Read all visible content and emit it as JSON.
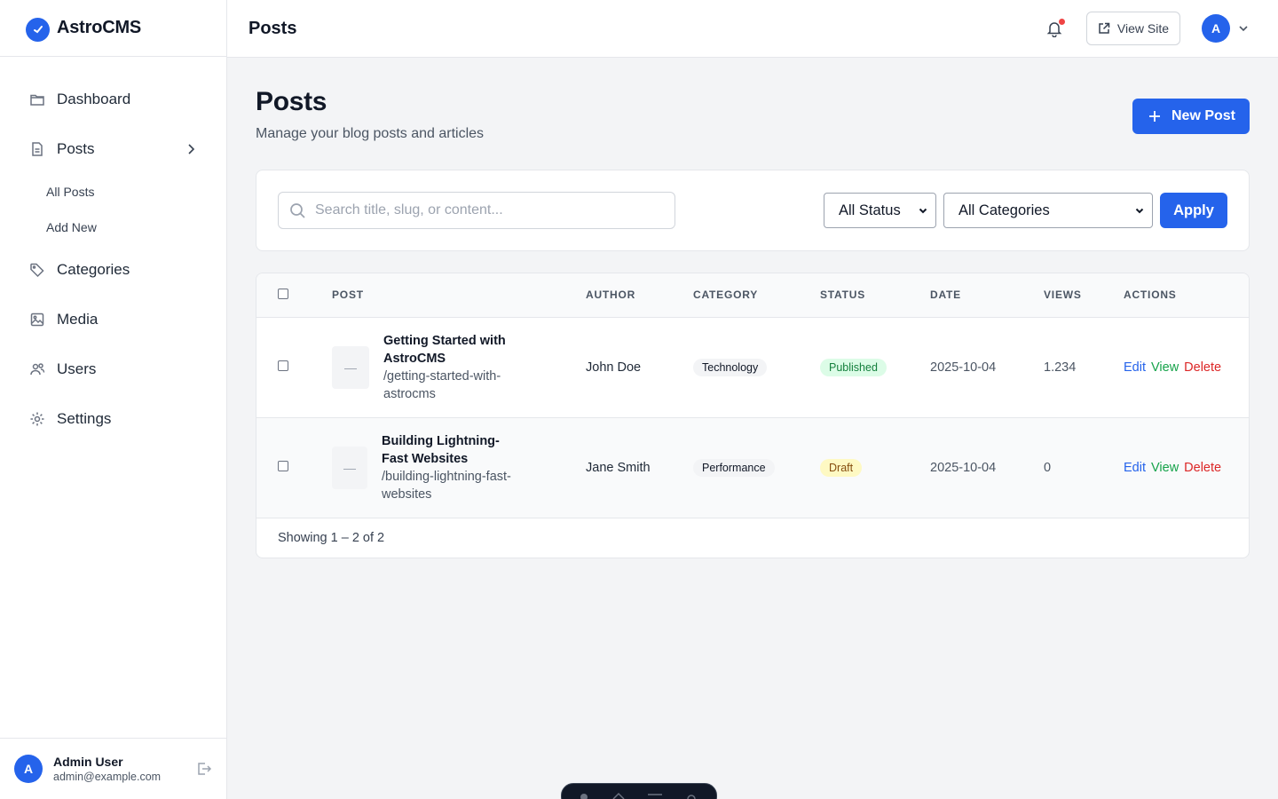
{
  "brand": {
    "name": "AstroCMS"
  },
  "sidebar": {
    "items": [
      {
        "label": "Dashboard"
      },
      {
        "label": "Posts"
      },
      {
        "label": "Categories"
      },
      {
        "label": "Media"
      },
      {
        "label": "Users"
      },
      {
        "label": "Settings"
      }
    ],
    "posts_sub": [
      {
        "label": "All Posts"
      },
      {
        "label": "Add New"
      }
    ],
    "user": {
      "initial": "A",
      "name": "Admin User",
      "email": "admin@example.com"
    }
  },
  "header": {
    "title": "Posts",
    "view_site_label": "View Site",
    "avatar_initial": "A",
    "has_notification": true
  },
  "page": {
    "title": "Posts",
    "subtitle": "Manage your blog posts and articles",
    "new_post_label": "New Post"
  },
  "filters": {
    "search_placeholder": "Search title, slug, or content...",
    "search_value": "",
    "status_selected": "All Status",
    "category_selected": "All Categories",
    "apply_label": "Apply"
  },
  "table": {
    "columns": [
      "POST",
      "AUTHOR",
      "CATEGORY",
      "STATUS",
      "DATE",
      "VIEWS",
      "ACTIONS"
    ],
    "rows": [
      {
        "thumb": "—",
        "title": "Getting Started with AstroCMS",
        "slug": "/getting-started-with-astrocms",
        "author": "John Doe",
        "category": "Technology",
        "status": "Published",
        "date": "2025-10-04",
        "views": "1.234",
        "edit": "Edit",
        "view": "View",
        "delete": "Delete"
      },
      {
        "thumb": "—",
        "title": "Building Lightning-Fast Websites",
        "slug": "/building-lightning-fast-websites",
        "author": "Jane Smith",
        "category": "Performance",
        "status": "Draft",
        "date": "2025-10-04",
        "views": "0",
        "edit": "Edit",
        "view": "View",
        "delete": "Delete"
      }
    ],
    "footer": "Showing 1 – 2 of 2"
  },
  "colors": {
    "accent": "#2563eb",
    "published": "#15803d",
    "draft": "#854d0e",
    "danger": "#dc2626"
  }
}
